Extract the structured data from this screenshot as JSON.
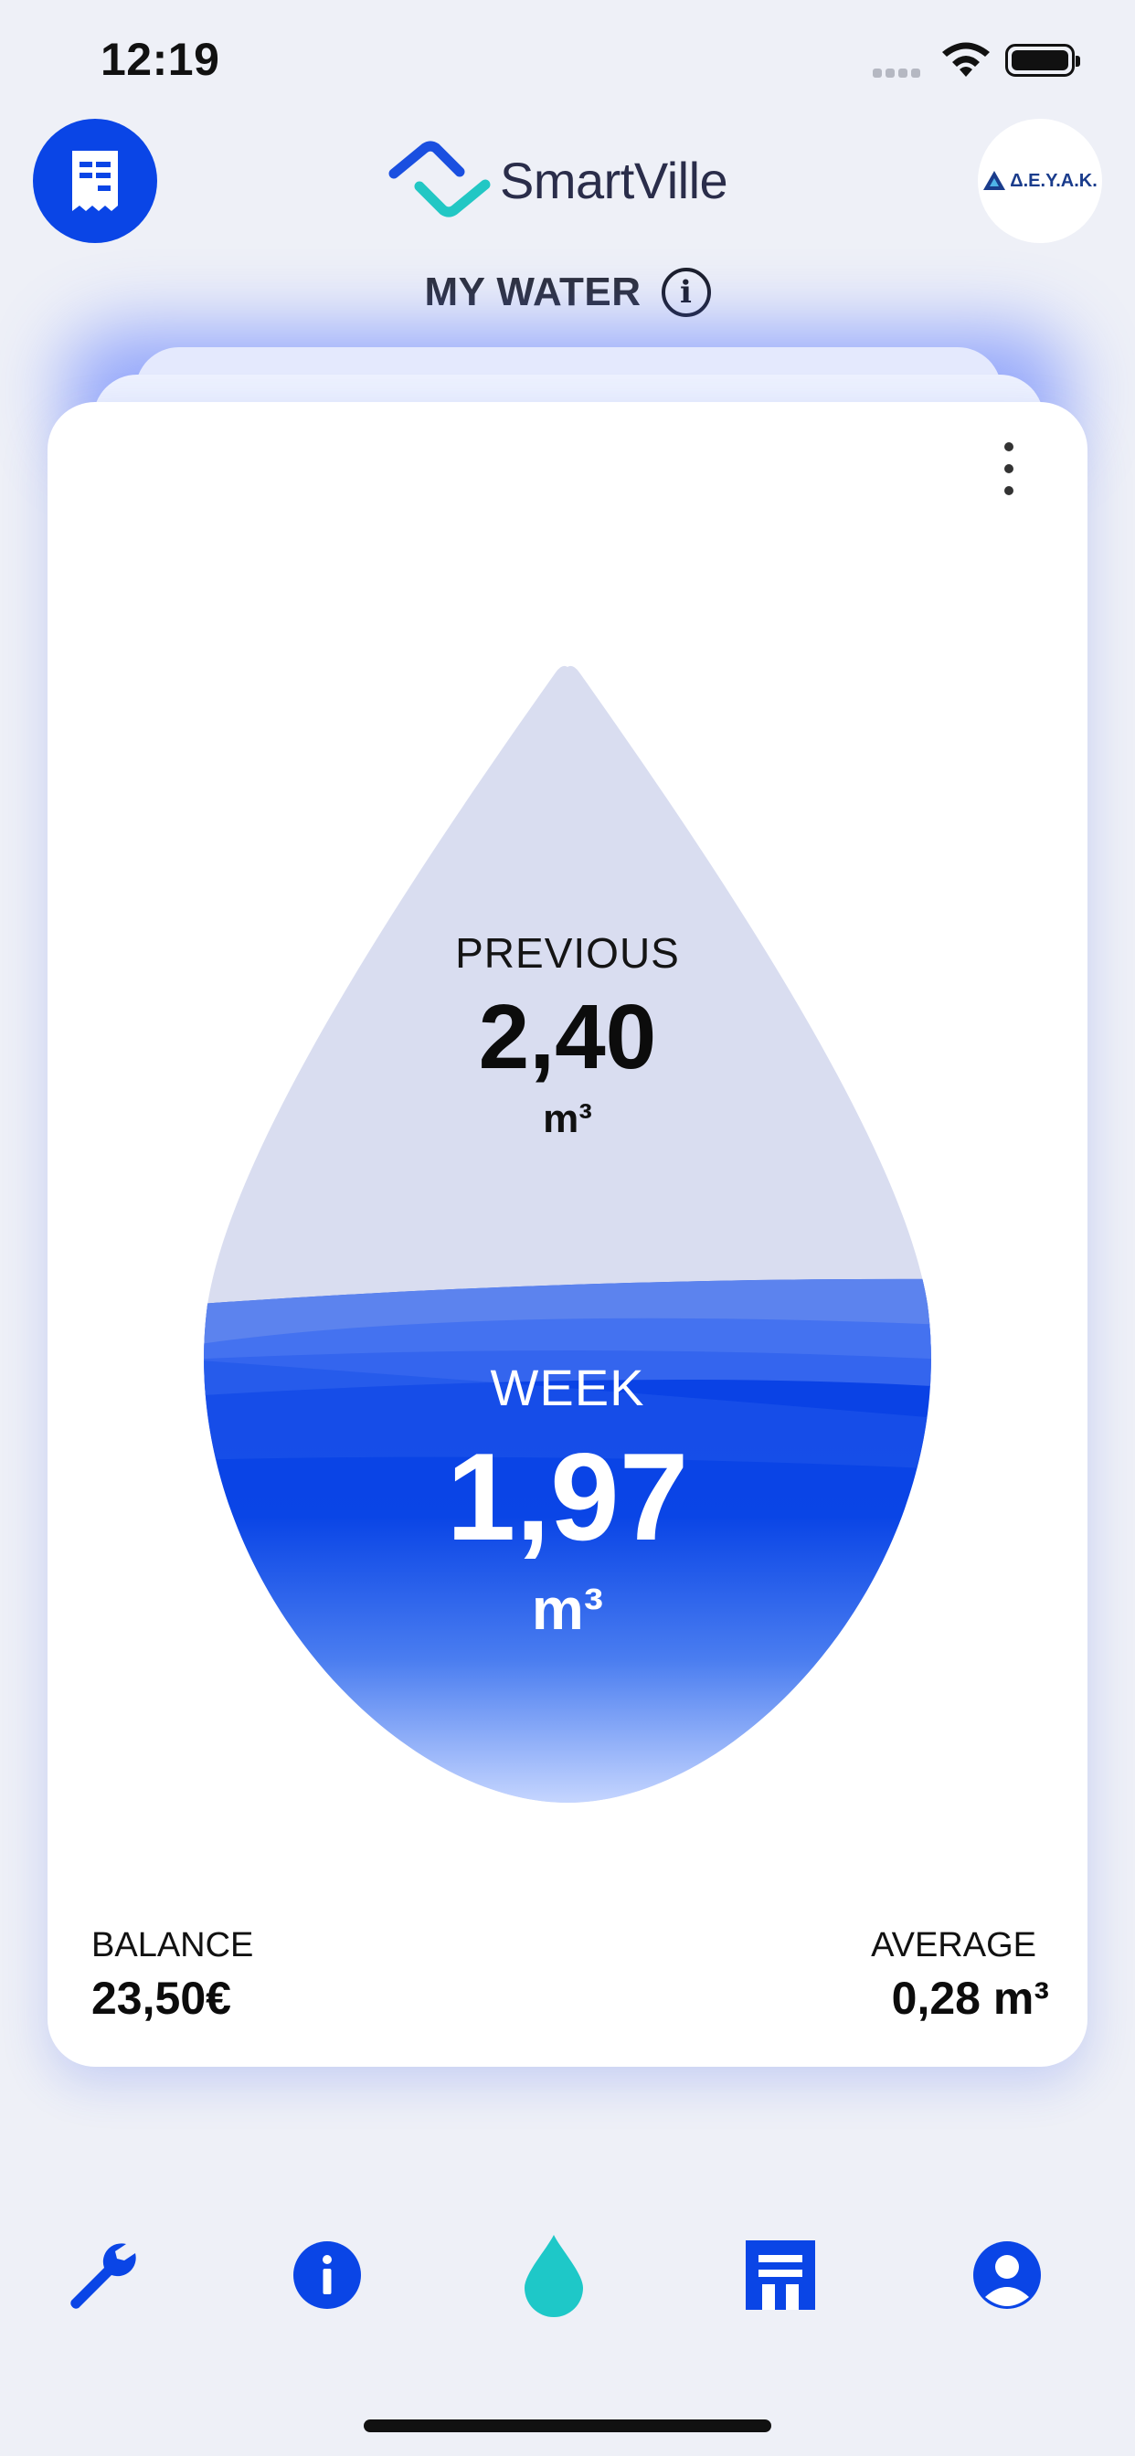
{
  "status_bar": {
    "time": "12:19"
  },
  "header": {
    "app_name": "SmartVille",
    "org_name": "Δ.Ε.Υ.Α.Κ."
  },
  "section": {
    "title": "MY WATER"
  },
  "card": {
    "previous_label": "PREVIOUS",
    "previous_value": "2,40",
    "previous_unit": "m³",
    "week_label": "WEEK",
    "week_value": "1,97",
    "week_unit": "m³",
    "week_fill_fraction": 0.82,
    "balance_label": "BALANCE",
    "balance_value": "23,50€",
    "average_label": "AVERAGE",
    "average_value": "0,28 m³"
  },
  "colors": {
    "accent": "#0a45e6",
    "active_tab": "#1ec8c8",
    "drop_empty": "#d9ddf0"
  },
  "nav": {
    "items": [
      {
        "icon": "wrench-icon"
      },
      {
        "icon": "info-icon"
      },
      {
        "icon": "water-drop-icon",
        "active": true
      },
      {
        "icon": "building-icon"
      },
      {
        "icon": "user-icon"
      }
    ]
  }
}
